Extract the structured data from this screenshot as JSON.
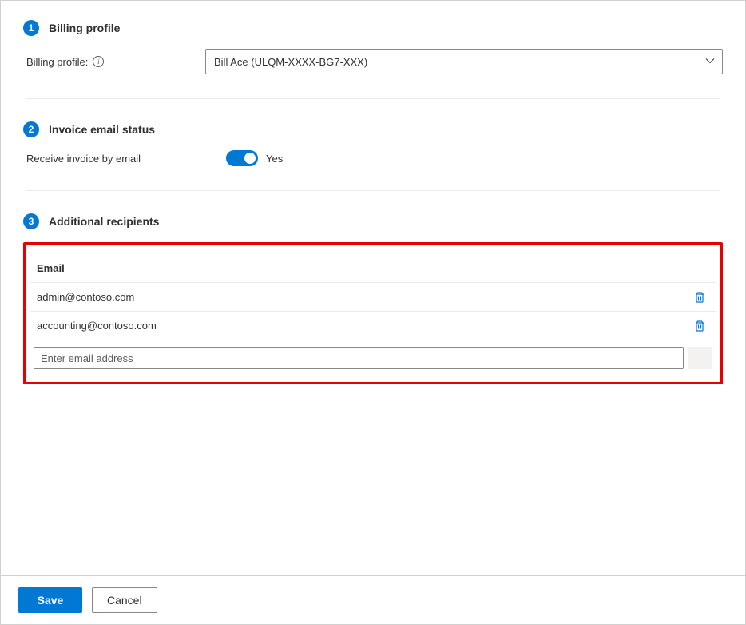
{
  "section1": {
    "step": "1",
    "title": "Billing profile",
    "field_label": "Billing profile:",
    "selected_value": "Bill Ace (ULQM-XXXX-BG7-XXX)"
  },
  "section2": {
    "step": "2",
    "title": "Invoice email status",
    "toggle_label": "Receive invoice by email",
    "toggle_state": "Yes"
  },
  "section3": {
    "step": "3",
    "title": "Additional recipients",
    "column_header": "Email",
    "rows": [
      {
        "email": "admin@contoso.com"
      },
      {
        "email": "accounting@contoso.com"
      }
    ],
    "input_placeholder": "Enter email address"
  },
  "footer": {
    "save": "Save",
    "cancel": "Cancel"
  }
}
